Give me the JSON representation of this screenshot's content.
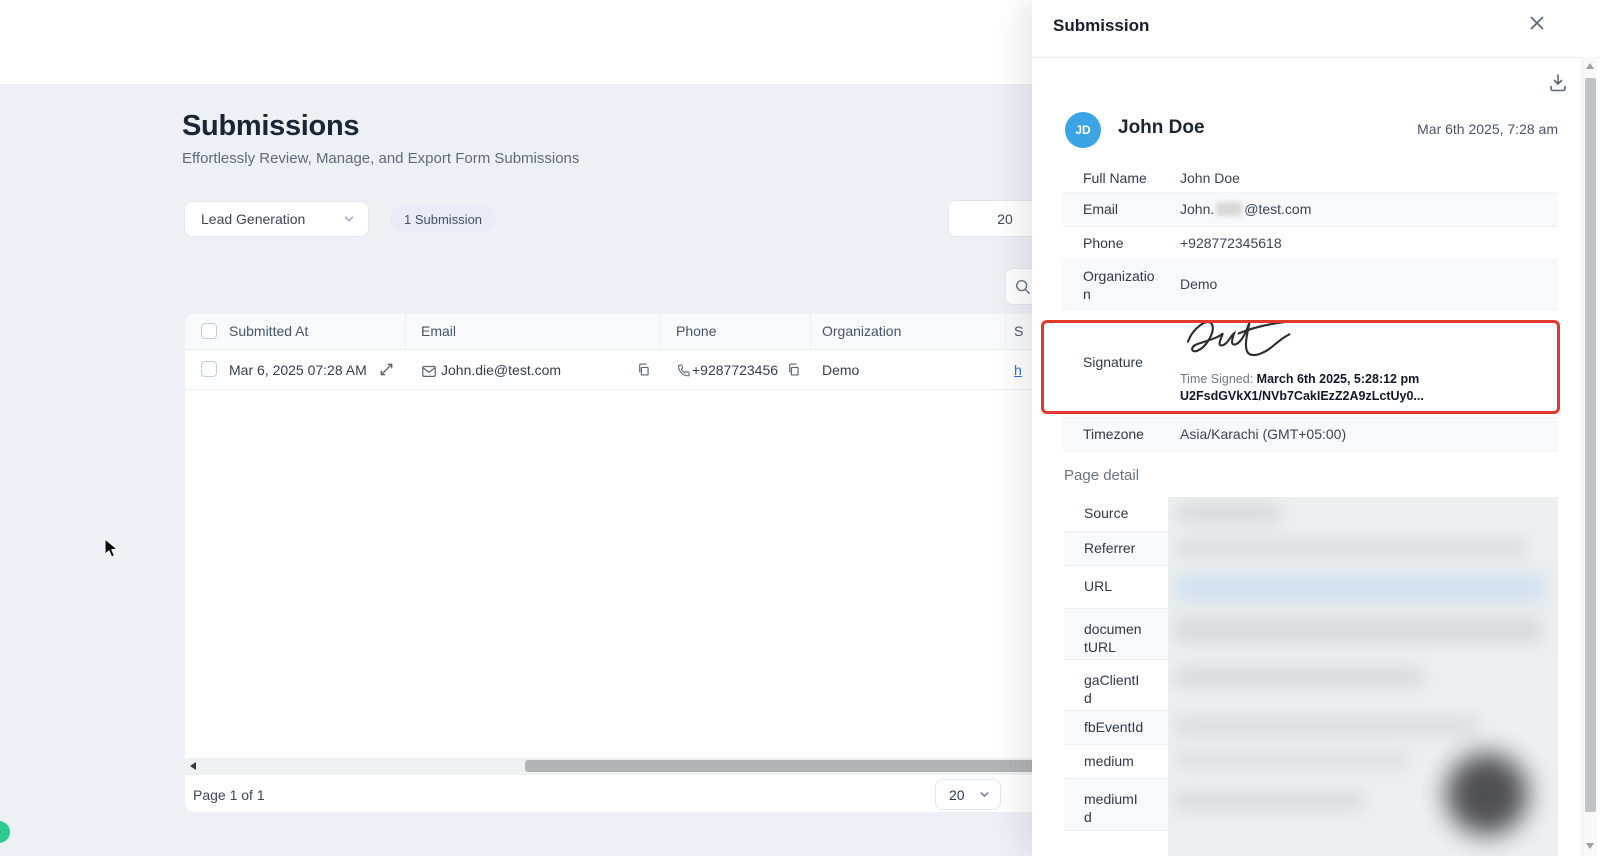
{
  "main": {
    "title": "Submissions",
    "subtitle": "Effortlessly Review, Manage, and Export Form Submissions",
    "filter_dropdown": "Lead Generation",
    "count_badge": "1 Submission",
    "top_page_size": "20",
    "table": {
      "headers": {
        "submitted_at": "Submitted At",
        "email": "Email",
        "phone": "Phone",
        "organization": "Organization",
        "signature_partial": "S"
      },
      "row": {
        "submitted_at": "Mar 6, 2025 07:28 AM",
        "email": "John.die@test.com",
        "phone": "+9287723456",
        "organization": "Demo",
        "signature_link_partial": "h"
      }
    },
    "pagination": {
      "label": "Page 1 of 1",
      "page_size": "20"
    }
  },
  "panel": {
    "title": "Submission",
    "submitter": {
      "initials": "JD",
      "name": "John Doe",
      "submitted_date": "Mar 6th 2025, 7:28 am"
    },
    "fields": {
      "full_name": {
        "label": "Full Name",
        "value": "John Doe"
      },
      "email": {
        "label": "Email",
        "value_prefix": "John.",
        "value_suffix": "@test.com"
      },
      "phone": {
        "label": "Phone",
        "value": "+928772345618"
      },
      "organization": {
        "label": "Organization",
        "value": "Demo"
      },
      "signature": {
        "label": "Signature",
        "time_signed_label": "Time Signed: ",
        "time_signed_value": "March 6th 2025, 5:28:12 pm",
        "signature_hash": "U2FsdGVkX1/NVb7CakIEzZ2A9zLctUy0..."
      },
      "timezone": {
        "label": "Timezone",
        "value": "Asia/Karachi (GMT+05:00)"
      }
    },
    "page_detail": {
      "heading": "Page detail",
      "labels": {
        "source": "Source",
        "referrer": "Referrer",
        "url": "URL",
        "document_url": "documentURL",
        "ga_client_id": "gaClientId",
        "fb_event_id": "fbEventId",
        "medium": "medium",
        "medium_id": "mediumId"
      }
    }
  },
  "icons": {
    "close": "x-mark",
    "download": "tray-arrow-down",
    "search": "magnifier",
    "chevron": "chevron-down",
    "mail": "envelope",
    "phone": "handset",
    "copy": "two-squares",
    "expand": "diagonal-arrows"
  },
  "colors": {
    "accent_red": "#e2382e",
    "avatar_blue": "#3ba4e4",
    "link_blue": "#2e6be6",
    "badge_bg": "#e9ecf6",
    "page_bg": "#edf1f5"
  }
}
